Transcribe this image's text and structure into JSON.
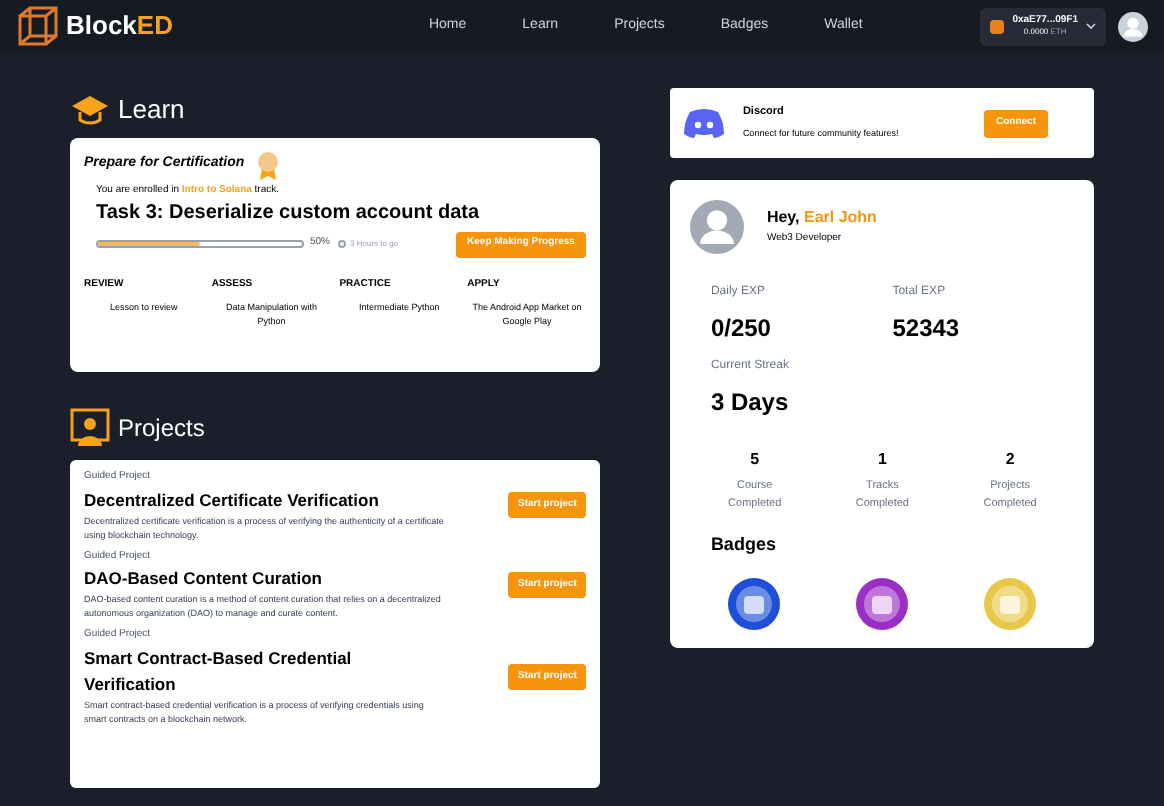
{
  "nav": {
    "logo": [
      "Block",
      "ED"
    ],
    "links": [
      "Home",
      "Learn",
      "Projects",
      "Badges",
      "Wallet"
    ],
    "wallet": {
      "address": "0xaE77...09F1",
      "balance": "0.0000",
      "unit": "ETH"
    }
  },
  "learn": {
    "title": "Learn",
    "card_title": "Prepare for Certification",
    "enrolled": "You are enrolled in **Intro to Solana** track.",
    "task": "Task 3: Deserialize custom account data",
    "progress": {
      "level": 0.5,
      "reading": "50%",
      "time": "3 Hours to go"
    },
    "button": "Keep Making Progress",
    "steps": [
      {
        "title": "REVIEW",
        "text": "Lesson to review"
      },
      {
        "title": "ASSESS",
        "text": "Data Manipulation with Python"
      },
      {
        "title": "PRACTICE",
        "text": "Intermediate Python"
      },
      {
        "title": "APPLY",
        "text": "The Android App Market on Google Play"
      }
    ]
  },
  "projects": {
    "title": "Projects",
    "items": [
      {
        "label": "Guided Project",
        "title": "Decentralized Certificate Verification",
        "description": "Decentralized certificate verification is a process of verifying the authenticity of a certificate using blockchain technology.",
        "button": "Start project"
      },
      {
        "label": "Guided Project",
        "title": "DAO-Based Content Curation",
        "description": "DAO-based content curation is a method of content curation that relies on a decentralized autonomous organization (DAO) to manage and curate content.",
        "button": "Start project"
      },
      {
        "label": "Guided Project",
        "title": "Smart Contract-Based Credential Verification",
        "description": "Smart contract-based credential verification is a process of verifying credentials using smart contracts on a blockchain network.",
        "button": "Start project"
      }
    ]
  },
  "discord": {
    "title": "Discord",
    "text": "Connect for future community features!",
    "button": "Connect"
  },
  "profile": {
    "greeting": "Hey,",
    "name": "Earl John",
    "role": "Web3 Developer",
    "stats": [
      {
        "label": "Daily EXP",
        "value": "0/250"
      },
      {
        "label": "Total EXP",
        "value": "52343"
      },
      {
        "label": "Current Streak",
        "value": "3 Days"
      }
    ],
    "counts": [
      {
        "value": "5",
        "label": "Course Completed"
      },
      {
        "value": "1",
        "label": "Tracks Completed"
      },
      {
        "value": "2",
        "label": "Projects Completed"
      }
    ],
    "badges_title": "Badges",
    "badges": [
      {
        "color": "#1d4fd8"
      },
      {
        "color": "#9b2fc4"
      },
      {
        "color": "#e8c84a"
      }
    ]
  }
}
